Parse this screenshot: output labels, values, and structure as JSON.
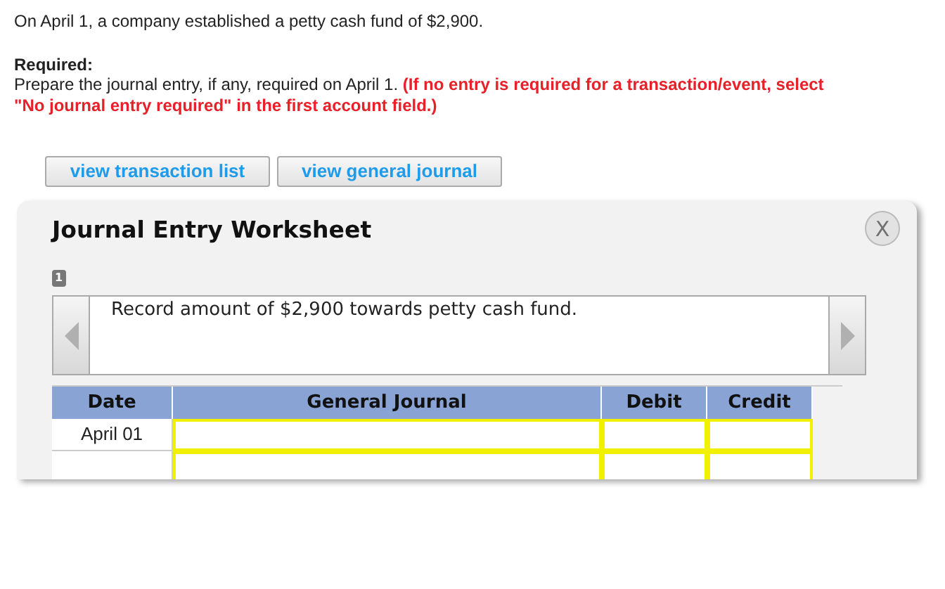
{
  "intro": "On April 1, a company established a petty cash fund of $2,900.",
  "required": {
    "heading": "Required:",
    "text": "Prepare the journal entry, if any, required on April 1.",
    "note": "(If no entry is required for a transaction/event, select \"No journal entry required\" in the first account field.)"
  },
  "buttons": [
    "view transaction list",
    "view general journal"
  ],
  "worksheet": {
    "title": "Journal Entry Worksheet",
    "close": "X",
    "step": "1",
    "description": "Record amount of $2,900 towards petty cash fund.",
    "columns": [
      "Date",
      "General Journal",
      "Debit",
      "Credit"
    ],
    "rows": [
      {
        "kind": "dated",
        "date": "April 01"
      },
      {
        "kind": "blank"
      }
    ]
  }
}
